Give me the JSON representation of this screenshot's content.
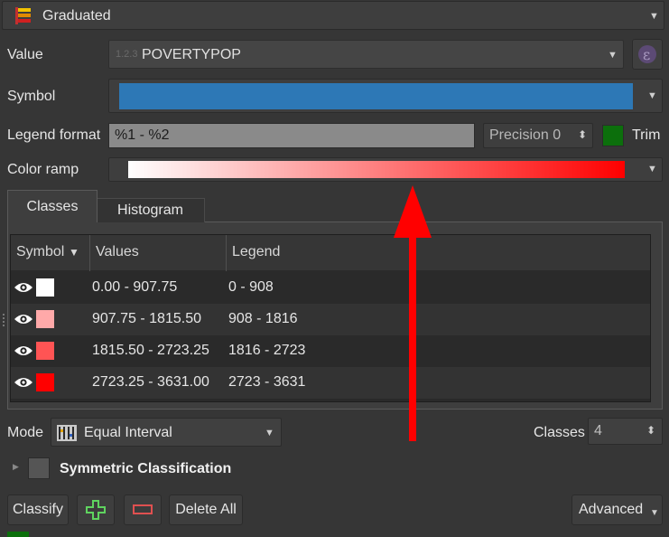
{
  "renderer": {
    "label": "Graduated"
  },
  "value": {
    "label": "Value",
    "type_badge": "1.2.3",
    "field": "POVERTYPOP"
  },
  "symbol": {
    "label": "Symbol",
    "color": "#2d78b6"
  },
  "legend_format": {
    "label": "Legend format",
    "value": "%1 - %2",
    "precision_text": "Precision 0",
    "trim_label": "Trim"
  },
  "color_ramp": {
    "label": "Color ramp",
    "start_color": "#ffffff",
    "end_color": "#ff0000"
  },
  "tabs": [
    {
      "label": "Classes"
    },
    {
      "label": "Histogram"
    }
  ],
  "table": {
    "columns": [
      "Symbol",
      "Values",
      "Legend"
    ],
    "rows": [
      {
        "color": "#ffffff",
        "values": "0.00 - 907.75",
        "legend": "0 - 908"
      },
      {
        "color": "#ffa9a9",
        "values": "907.75 - 1815.50",
        "legend": "908 - 1816"
      },
      {
        "color": "#ff5454",
        "values": "1815.50 - 2723.25",
        "legend": "1816 - 2723"
      },
      {
        "color": "#ff0000",
        "values": "2723.25 - 3631.00",
        "legend": "2723 - 3631"
      }
    ]
  },
  "mode": {
    "label": "Mode",
    "value": "Equal Interval"
  },
  "classes": {
    "label": "Classes",
    "value": "4"
  },
  "symmetric": {
    "label": "Symmetric Classification"
  },
  "buttons": {
    "classify": "Classify",
    "delete_all": "Delete All",
    "advanced": "Advanced"
  },
  "annotation": {
    "arrow_color": "#ff0000"
  }
}
